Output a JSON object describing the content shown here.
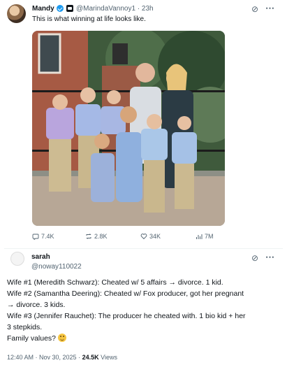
{
  "tweet": {
    "author_name": "Mandy",
    "handle": "@MarindaVannoy1",
    "time": "· 23h",
    "text": "This is what winning at life looks like.",
    "stats": {
      "replies": "7.4K",
      "retweets": "2.8K",
      "likes": "34K",
      "views": "7M"
    }
  },
  "quote": {
    "author_name": "sarah",
    "handle": "@noway110022",
    "lines": [
      "Wife #1 (Meredith Schwarz): Cheated w/ 5 affairs → divorce. 1 kid.",
      "Wife #2 (Samantha Deering): Cheated w/ Fox producer, got her pregnant",
      "→ divorce. 3 kids.",
      "Wife #3 (Jennifer Rauchet): The producer he cheated with. 1 bio kid + her",
      "3 stepkids.",
      "Family values?"
    ],
    "time": "12:40 AM · Nov 30, 2025 ·",
    "views_count": "24.5K",
    "views_label": "Views"
  },
  "colors": {
    "verified": "#1d9bf0",
    "muted": "#536471",
    "brick": "#a65a44"
  },
  "icons": [
    "verified-icon",
    "grok-icon",
    "more-icon",
    "reply-icon",
    "retweet-icon",
    "like-icon",
    "views-icon",
    "smile-emoji"
  ]
}
